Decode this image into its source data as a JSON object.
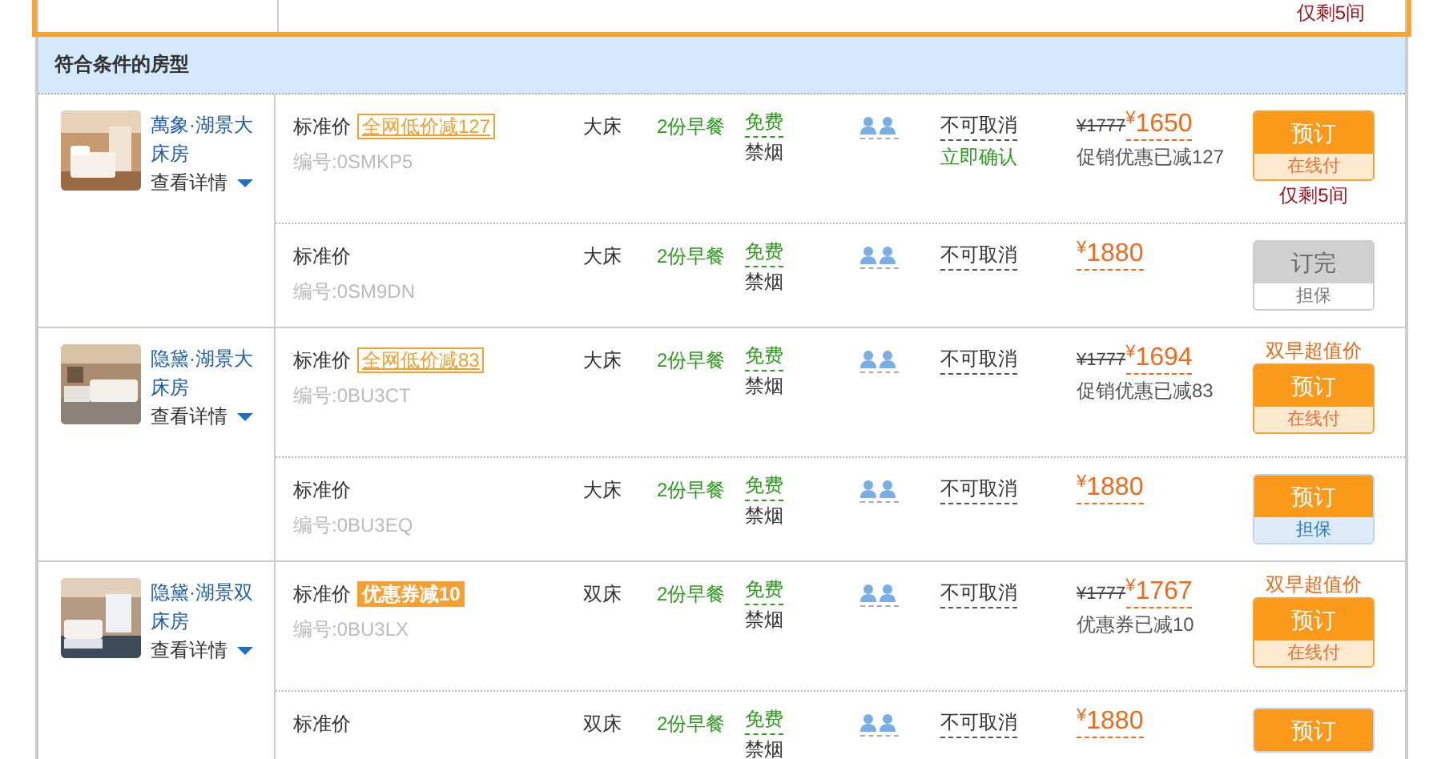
{
  "previous_room": {
    "remaining": "仅剩5间"
  },
  "section_title": "符合条件的房型",
  "rooms": [
    {
      "name": "萬象·湖景大床房",
      "details_label": "查看详情",
      "rates": [
        {
          "name": "标准价",
          "promo": {
            "text": "全网低价减127",
            "kind": "outline"
          },
          "code": "编号:0SMKP5",
          "bed": "大床",
          "breakfast": "2份早餐",
          "wifi": "免费",
          "smoking": "禁烟",
          "cancel": "不可取消",
          "confirm": "立即确认",
          "original_price": "¥1777",
          "price": "$^{¥}$1650",
          "discount_note": "促销优惠已减127",
          "button": {
            "label": "预订",
            "sub": "在线付",
            "kind": "online"
          },
          "remaining": "仅剩5间"
        },
        {
          "name": "标准价",
          "code": "编号:0SM9DN",
          "bed": "大床",
          "breakfast": "2份早餐",
          "wifi": "免费",
          "smoking": "禁烟",
          "cancel": "不可取消",
          "price": "$^{¥}$1880",
          "button": {
            "label": "订完",
            "sub": "担保",
            "kind": "soldout"
          }
        }
      ]
    },
    {
      "name": "隐黛·湖景大床房",
      "details_label": "查看详情",
      "rates": [
        {
          "name": "标准价",
          "promo": {
            "text": "全网低价减83",
            "kind": "outline"
          },
          "code": "编号:0BU3CT",
          "bed": "大床",
          "breakfast": "2份早餐",
          "wifi": "免费",
          "smoking": "禁烟",
          "cancel": "不可取消",
          "original_price": "¥1777",
          "price": "$^{¥}$1694",
          "discount_note": "促销优惠已减83",
          "tag": "双早超值价",
          "button": {
            "label": "预订",
            "sub": "在线付",
            "kind": "online"
          }
        },
        {
          "name": "标准价",
          "code": "编号:0BU3EQ",
          "bed": "大床",
          "breakfast": "2份早餐",
          "wifi": "免费",
          "smoking": "禁烟",
          "cancel": "不可取消",
          "price": "$^{¥}$1880",
          "button": {
            "label": "预订",
            "sub": "担保",
            "kind": "guarantee"
          }
        }
      ]
    },
    {
      "name": "隐黛·湖景双床房",
      "details_label": "查看详情",
      "rates": [
        {
          "name": "标准价",
          "promo": {
            "text": "优惠券减10",
            "kind": "filled"
          },
          "code": "编号:0BU3LX",
          "bed": "双床",
          "breakfast": "2份早餐",
          "wifi": "免费",
          "smoking": "禁烟",
          "cancel": "不可取消",
          "original_price": "¥1777",
          "price": "$^{¥}$1767",
          "discount_note": "优惠券已减10",
          "tag": "双早超值价",
          "button": {
            "label": "预订",
            "sub": "在线付",
            "kind": "online"
          }
        },
        {
          "name": "标准价",
          "bed": "双床",
          "breakfast": "2份早餐",
          "wifi": "免费",
          "smoking": "禁烟",
          "cancel": "不可取消",
          "price": "$^{¥}$1880",
          "button": {
            "label": "预订",
            "kind": "guarantee"
          }
        }
      ]
    }
  ]
}
